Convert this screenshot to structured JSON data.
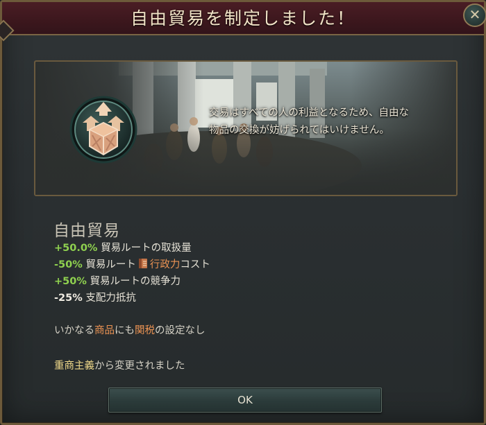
{
  "window": {
    "title": "自由貿易を制定しました！",
    "close_glyph": "✕"
  },
  "event": {
    "quote": "交易はすべての人の利益となるため、自由な物品の交換が妨げられてはいけません。",
    "emblem_icon": "free-trade-crates-icon"
  },
  "modifier": {
    "name": "自由貿易",
    "effects": [
      {
        "value": "+50.0%",
        "text": " 貿易ルートの取扱量"
      },
      {
        "value": "-50%",
        "text": " 貿易ルート",
        "icon": "administration-scroll-icon",
        "keyword": "行政力",
        "suffix": "コスト"
      },
      {
        "value": "+50%",
        "text": " 貿易ルートの競争力"
      },
      {
        "value": "-25%",
        "text": " 支配力抵抗"
      }
    ]
  },
  "tariff": {
    "prefix": "いかなる",
    "goods": "商品",
    "middle": "にも",
    "tariffs": "関税",
    "suffix": "の設定なし"
  },
  "change": {
    "policy": "重商主義",
    "suffix": "から変更されました"
  },
  "buttons": {
    "ok_label": "OK"
  },
  "colors": {
    "positive": "#8fd14f",
    "keyword_orange": "#ec9353",
    "policy_yellow": "#f0d98a",
    "title_bar": "#4a1d24",
    "frame_gold": "#6d5a3a"
  }
}
